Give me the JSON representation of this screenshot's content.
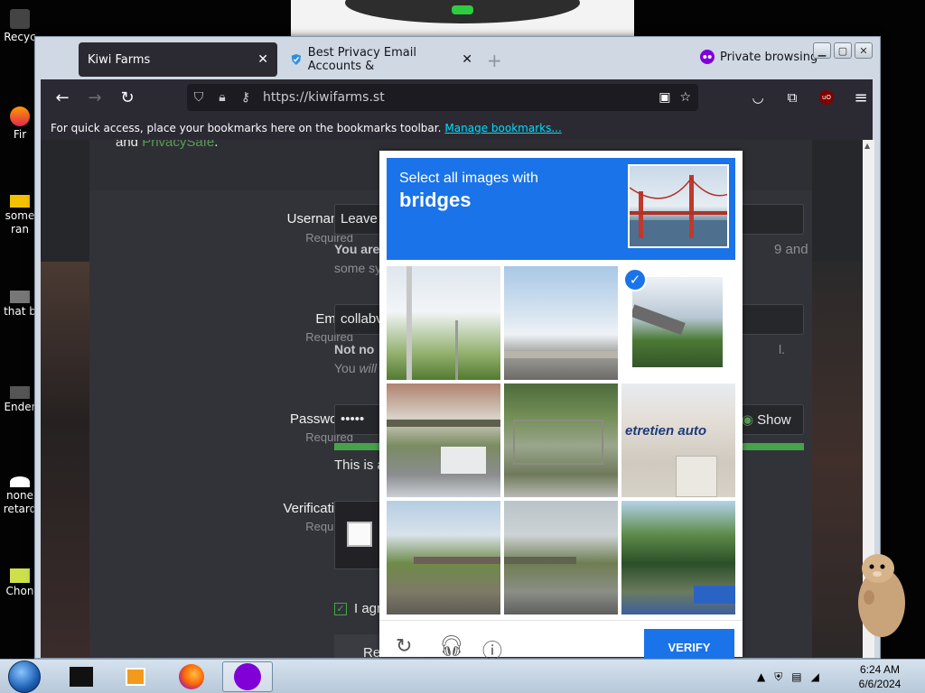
{
  "desktop": {
    "icons": [
      "Recyc",
      "Fir",
      "some ran",
      "that b",
      "Ender",
      "none retard",
      "Chon"
    ]
  },
  "browser": {
    "tabs": [
      {
        "label": "Kiwi Farms",
        "active": true
      },
      {
        "label": "Best Privacy Email Accounts &",
        "active": false
      }
    ],
    "private_label": "Private browsing",
    "url_host": "https://kiwifarms.st",
    "bookmarks_text": "For quick access, place your bookmarks here on the bookmarks toolbar.",
    "bookmarks_link": "Manage bookmarks..."
  },
  "page": {
    "privacy_prefix": "and",
    "privacy_link": "PrivacySafe",
    "privacy_suffix": ".",
    "form": {
      "username_label": "Username:",
      "username_req": "Required",
      "username_value": "Leave",
      "username_hint": "You are",
      "username_hint2": "some sy",
      "username_hint_right": "9 and",
      "email_label": "Email:",
      "email_req": "Required",
      "email_value": "collabv",
      "email_hint_bold": "Not no",
      "email_hint_right": "l.",
      "email_hint2": "You",
      "email_hint2_em": "will",
      "password_label": "Password:",
      "password_req": "Required",
      "password_value": "•••••",
      "show_label": "Show",
      "password_hint": "This is a",
      "verification_label": "Verification:",
      "verification_req": "Required",
      "agree_text": "I agr",
      "register_label": "Re"
    }
  },
  "captcha": {
    "instruction": "Select all images with",
    "keyword": "bridges",
    "tiles": [
      {
        "name": "lamp-post",
        "selected": false
      },
      {
        "name": "highway-sky",
        "selected": false
      },
      {
        "name": "overpass",
        "selected": true
      },
      {
        "name": "elevated-railway",
        "selected": false
      },
      {
        "name": "fenced-trees",
        "selected": false
      },
      {
        "name": "auto-shop",
        "selected": false
      },
      {
        "name": "footbridge-trees",
        "selected": false
      },
      {
        "name": "footbridge-road",
        "selected": false
      },
      {
        "name": "parking-lot",
        "selected": false
      }
    ],
    "auto_shop_text": "etretien auto",
    "verify_label": "VERIFY",
    "selected_color": "#1a73e8"
  },
  "taskbar": {
    "time": "6:24 AM",
    "date": "6/6/2024"
  }
}
